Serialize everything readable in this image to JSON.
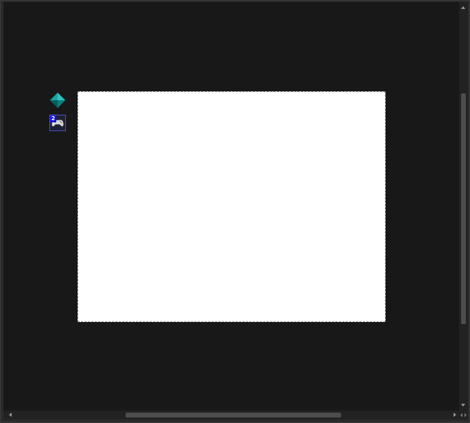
{
  "app": {
    "background_color": "#181818",
    "canvas_color": "#ffffff"
  },
  "toolbox": {
    "items": [
      {
        "icon": "diamond-icon",
        "color": "#1fa3a3"
      },
      {
        "icon": "gamepad-icon",
        "badge": "2",
        "badge_color": "#1010e6"
      }
    ]
  },
  "scrollbars": {
    "vertical": {
      "icons": [
        "scroll-up-arrow-icon",
        "scroll-down-arrow-icon"
      ]
    },
    "horizontal": {
      "icons": [
        "scroll-left-arrow-icon",
        "scroll-right-arrow-icon"
      ]
    }
  }
}
